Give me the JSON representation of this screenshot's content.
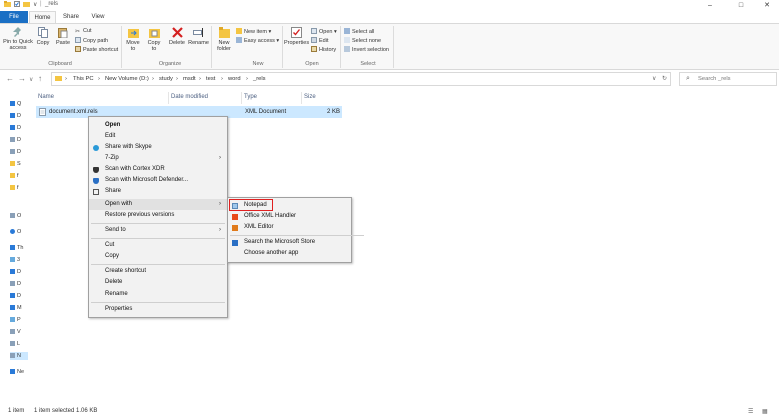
{
  "titlebar": {
    "path_name": "_rels",
    "minimize": "–",
    "maximize": "□",
    "close": "✕"
  },
  "tabs": [
    "File",
    "Home",
    "Share",
    "View"
  ],
  "ribbon": {
    "clipboard": {
      "pin": "Pin to Quick access",
      "copy": "Copy",
      "paste": "Paste",
      "cut": "Cut",
      "copy_path": "Copy path",
      "paste_shortcut": "Paste shortcut",
      "group": "Clipboard"
    },
    "organize": {
      "move_to": "Move to",
      "copy_to": "Copy to",
      "delete": "Delete",
      "rename": "Rename",
      "group": "Organize"
    },
    "new": {
      "new_folder": "New folder",
      "new_item": "New item",
      "easy_access": "Easy access",
      "group": "New"
    },
    "open": {
      "properties": "Properties",
      "open": "Open",
      "edit": "Edit",
      "history": "History",
      "group": "Open"
    },
    "select": {
      "select_all": "Select all",
      "select_none": "Select none",
      "invert": "Invert selection",
      "group": "Select"
    }
  },
  "address": {
    "crumbs": [
      "This PC",
      "New Volume (D:)",
      "study",
      "msdt",
      "test",
      "word",
      "_rels"
    ],
    "search_placeholder": "Search _rels"
  },
  "navpane": [
    "Q",
    "D",
    "D",
    "D",
    "D",
    "S",
    "f",
    "f",
    "O",
    "O",
    "Th",
    "3",
    "D",
    "D",
    "D",
    "M",
    "P",
    "V",
    "L",
    "N",
    "Ne"
  ],
  "columns": {
    "name": "Name",
    "date": "Date modified",
    "type": "Type",
    "size": "Size"
  },
  "file": {
    "name": "document.xml.rels",
    "type": "XML Document",
    "size": "2 KB"
  },
  "context_menu": [
    "Open",
    "Edit",
    "Share with Skype",
    "7-Zip",
    "Scan with Cortex XDR",
    "Scan with Microsoft Defender...",
    "Share",
    "Open with",
    "Restore previous versions",
    "Send to",
    "Cut",
    "Copy",
    "Create shortcut",
    "Delete",
    "Rename",
    "Properties"
  ],
  "submenu": [
    "Notepad",
    "Office XML Handler",
    "XML Editor",
    "Search the Microsoft Store",
    "Choose another app"
  ],
  "status": {
    "items": "1 item",
    "selected": "1 item selected  1.06 KB"
  },
  "colors": {
    "accent": "#1a6fc4",
    "selection": "#cce8ff",
    "highlight_box": "#e02020"
  }
}
